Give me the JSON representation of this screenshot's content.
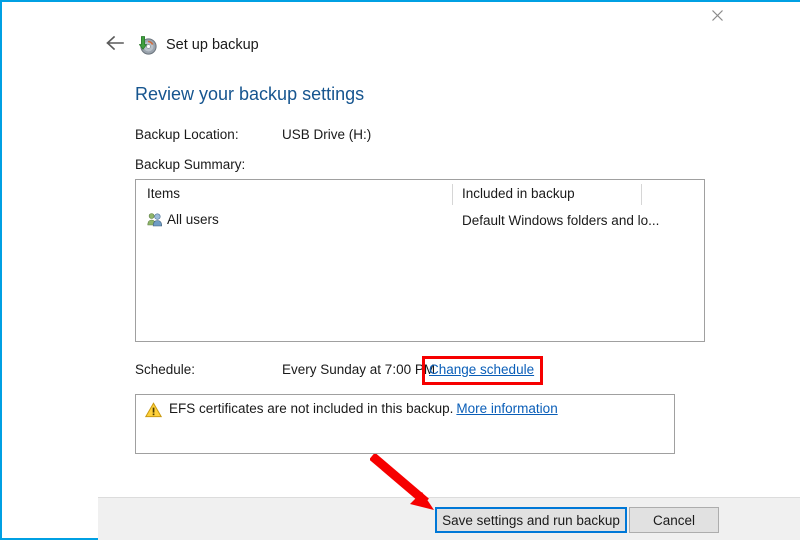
{
  "window": {
    "border_color": "#00a0e3",
    "close_icon": "close-icon"
  },
  "nav": {
    "back_icon": "back-arrow-icon",
    "app_icon": "backup-disc-icon",
    "title": "Set up backup"
  },
  "page": {
    "heading": "Review your backup settings",
    "heading_color": "#16558f"
  },
  "fields": {
    "backup_location_label": "Backup Location:",
    "backup_location_value": "USB Drive (H:)",
    "backup_summary_label": "Backup Summary:",
    "schedule_label": "Schedule:",
    "schedule_value": "Every Sunday at 7:00 PM",
    "change_schedule_link": "Change schedule",
    "change_schedule_highlight_color": "#f60000"
  },
  "summary_table": {
    "columns": [
      "Items",
      "Included in backup"
    ],
    "rows": [
      {
        "icon": "all-users-icon",
        "item": "All users",
        "included": "Default Windows folders and lo..."
      }
    ]
  },
  "warning": {
    "icon": "warning-triangle-icon",
    "message": "EFS certificates are not included in this backup.",
    "link": "More information"
  },
  "footer": {
    "primary_button": "Save settings and run backup",
    "cancel_button": "Cancel",
    "primary_focus_color": "#0078d7"
  },
  "annotation": {
    "arrow_color": "#f60000",
    "arrow_target": "save-settings-and-run-backup-button"
  }
}
